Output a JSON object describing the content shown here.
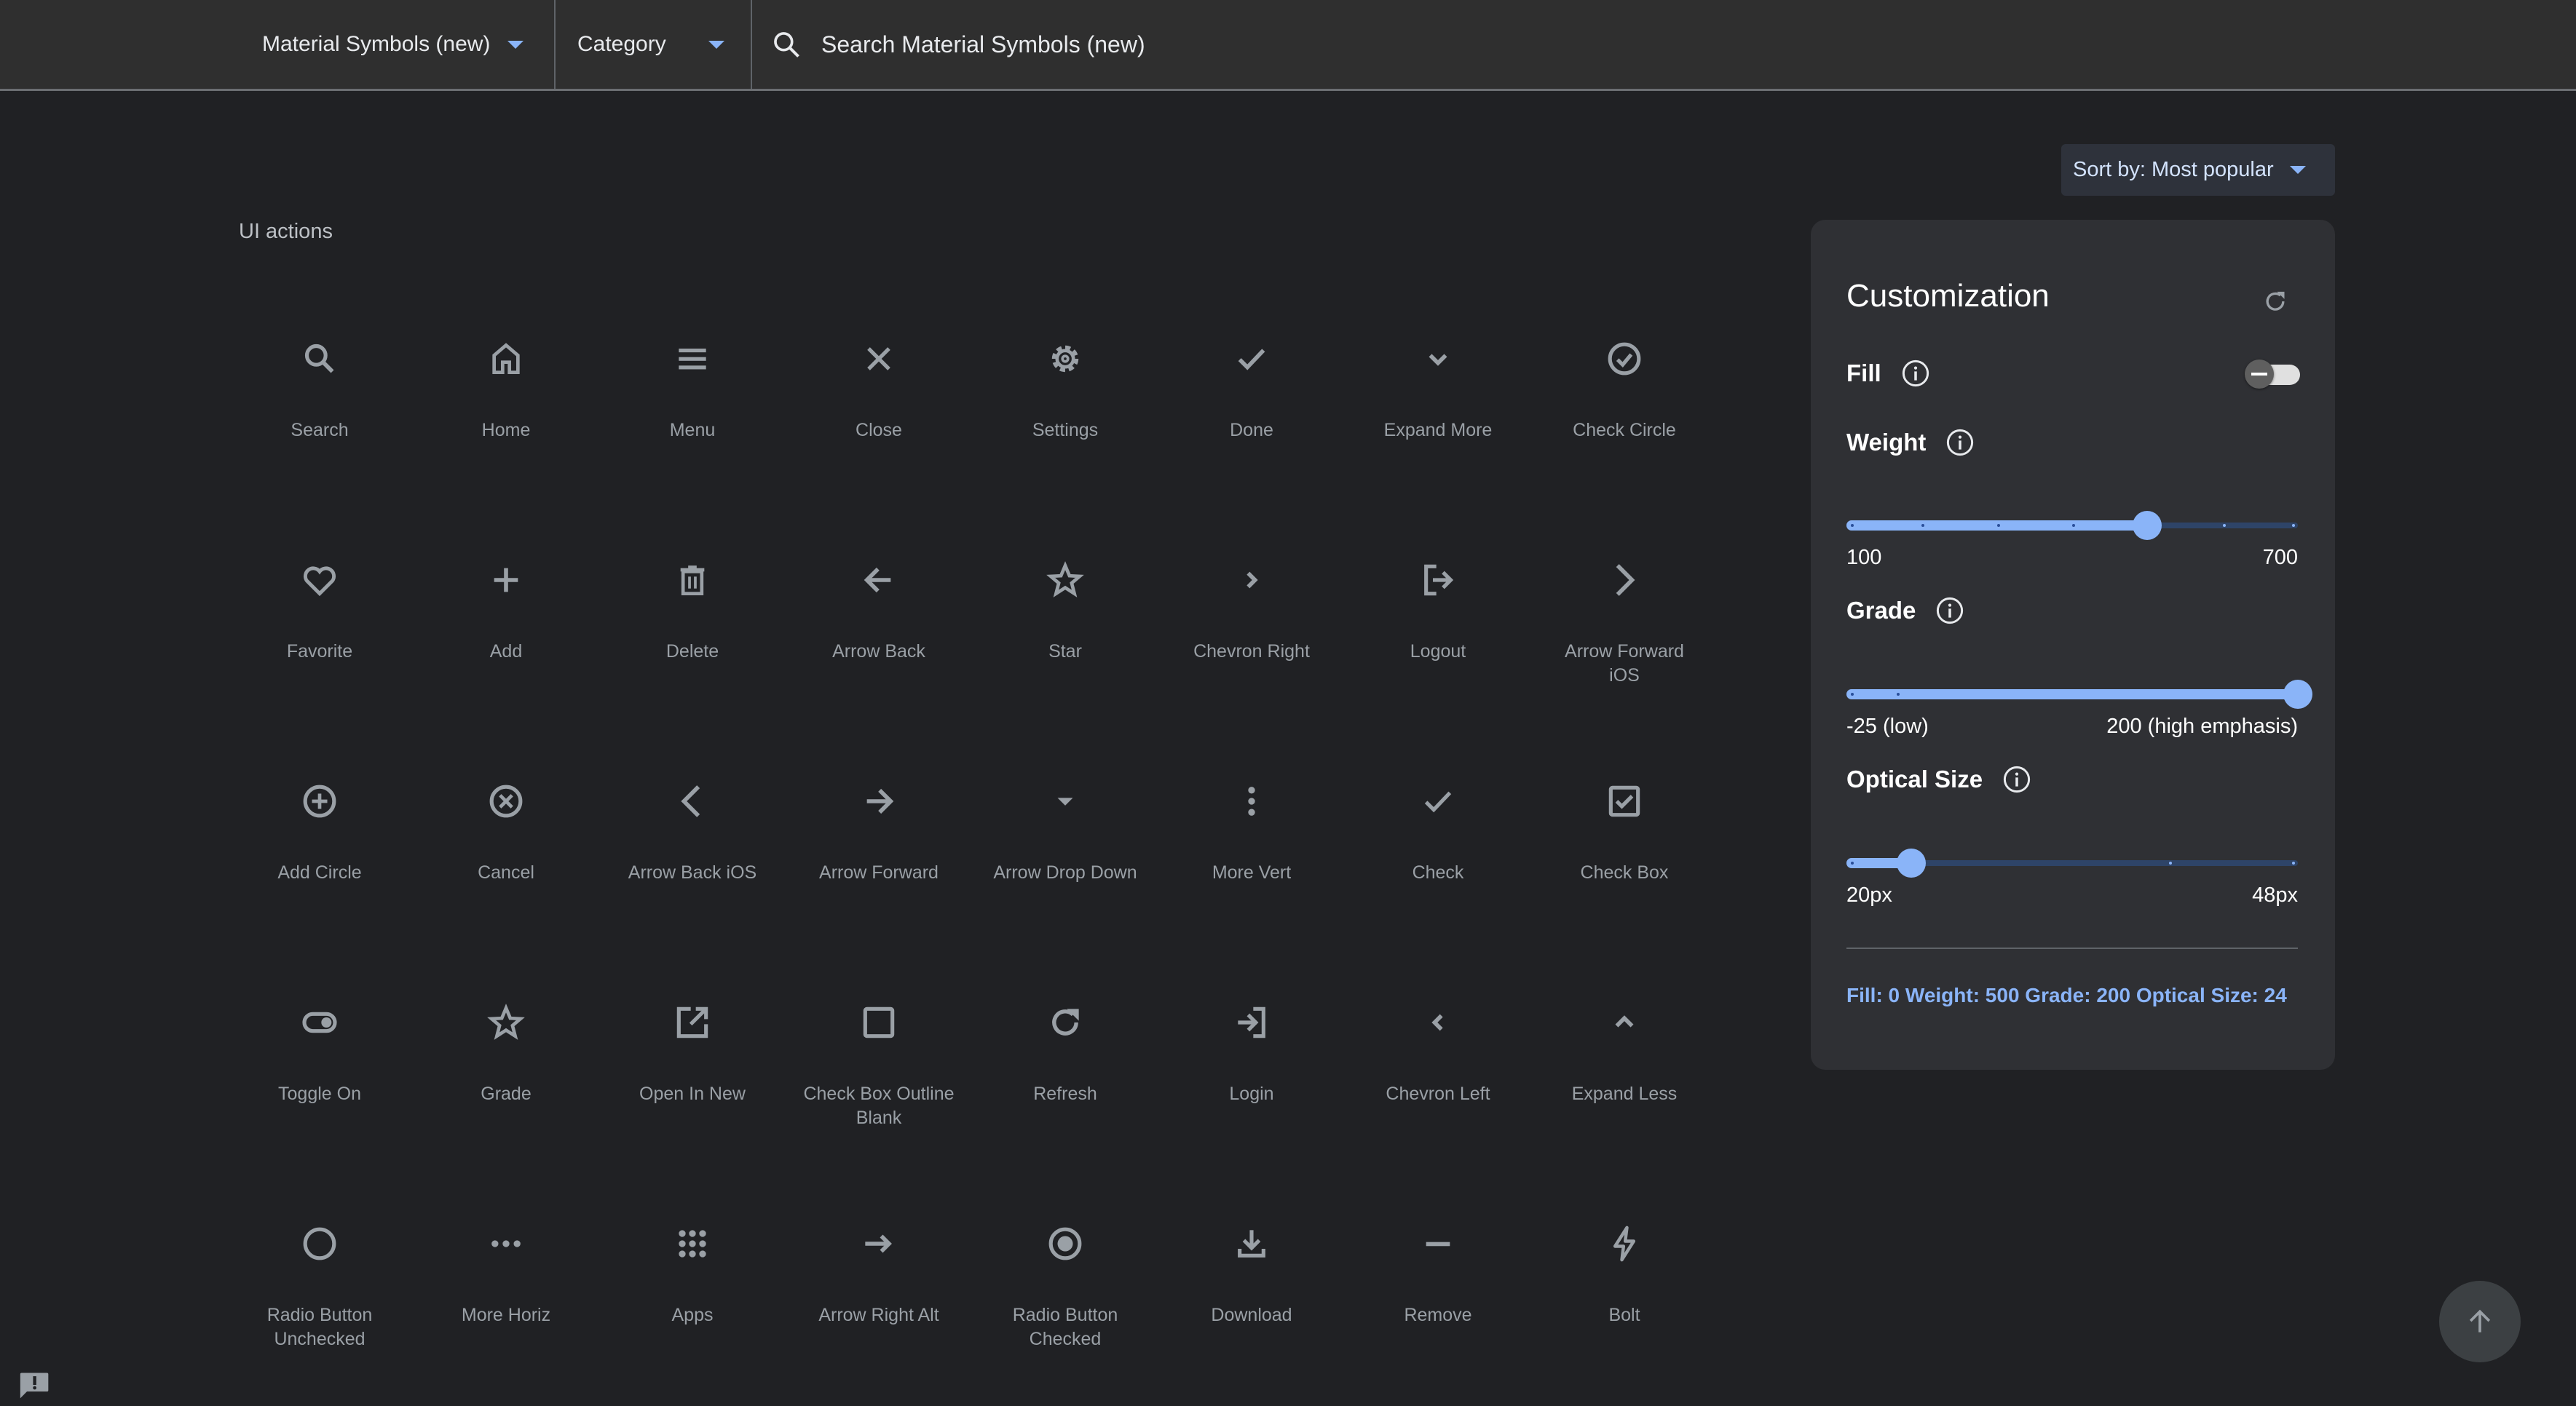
{
  "header": {
    "icon_set_dropdown": "Material Symbols (new)",
    "category_dropdown": "Category",
    "search_placeholder": "Search Material Symbols (new)",
    "search_value": "",
    "search_icon": "search-icon"
  },
  "sort": {
    "label": "Sort by: Most popular"
  },
  "section": {
    "title": "UI actions"
  },
  "icons": [
    {
      "label": "Search",
      "icon": "search"
    },
    {
      "label": "Home",
      "icon": "home"
    },
    {
      "label": "Menu",
      "icon": "menu"
    },
    {
      "label": "Close",
      "icon": "close"
    },
    {
      "label": "Settings",
      "icon": "settings"
    },
    {
      "label": "Done",
      "icon": "done"
    },
    {
      "label": "Expand More",
      "icon": "expand_more"
    },
    {
      "label": "Check Circle",
      "icon": "check_circle"
    },
    {
      "label": "Favorite",
      "icon": "favorite"
    },
    {
      "label": "Add",
      "icon": "add"
    },
    {
      "label": "Delete",
      "icon": "delete"
    },
    {
      "label": "Arrow Back",
      "icon": "arrow_back"
    },
    {
      "label": "Star",
      "icon": "star"
    },
    {
      "label": "Chevron Right",
      "icon": "chevron_right"
    },
    {
      "label": "Logout",
      "icon": "logout"
    },
    {
      "label": "Arrow Forward iOS",
      "icon": "arrow_forward_ios"
    },
    {
      "label": "Add Circle",
      "icon": "add_circle"
    },
    {
      "label": "Cancel",
      "icon": "cancel"
    },
    {
      "label": "Arrow Back iOS",
      "icon": "arrow_back_ios"
    },
    {
      "label": "Arrow Forward",
      "icon": "arrow_forward"
    },
    {
      "label": "Arrow Drop Down",
      "icon": "arrow_drop_down"
    },
    {
      "label": "More Vert",
      "icon": "more_vert"
    },
    {
      "label": "Check",
      "icon": "check"
    },
    {
      "label": "Check Box",
      "icon": "check_box"
    },
    {
      "label": "Toggle On",
      "icon": "toggle_on"
    },
    {
      "label": "Grade",
      "icon": "grade"
    },
    {
      "label": "Open In New",
      "icon": "open_in_new"
    },
    {
      "label": "Check Box Outline Blank",
      "icon": "check_box_outline_blank"
    },
    {
      "label": "Refresh",
      "icon": "refresh"
    },
    {
      "label": "Login",
      "icon": "login"
    },
    {
      "label": "Chevron Left",
      "icon": "chevron_left"
    },
    {
      "label": "Expand Less",
      "icon": "expand_less"
    },
    {
      "label": "Radio Button Unchecked",
      "icon": "radio_button_unchecked"
    },
    {
      "label": "More Horiz",
      "icon": "more_horiz"
    },
    {
      "label": "Apps",
      "icon": "apps"
    },
    {
      "label": "Arrow Right Alt",
      "icon": "arrow_right_alt"
    },
    {
      "label": "Radio Button Checked",
      "icon": "radio_button_checked"
    },
    {
      "label": "Download",
      "icon": "download"
    },
    {
      "label": "Remove",
      "icon": "remove"
    },
    {
      "label": "Bolt",
      "icon": "bolt"
    }
  ],
  "customization": {
    "title": "Customization",
    "fill": {
      "label": "Fill",
      "value": 0,
      "enabled": false
    },
    "weight": {
      "label": "Weight",
      "min": 100,
      "max": 700,
      "value": 500,
      "min_label": "100",
      "max_label": "700",
      "steps": [
        100,
        200,
        300,
        400,
        500,
        600,
        700
      ]
    },
    "grade": {
      "label": "Grade",
      "min": -25,
      "max": 200,
      "value": 200,
      "min_label": "-25 (low)",
      "max_label": "200 (high emphasis)",
      "steps": [
        -25,
        0,
        200
      ]
    },
    "optical_size": {
      "label": "Optical Size",
      "min": 20,
      "max": 48,
      "value": 24,
      "min_label": "20px",
      "max_label": "48px",
      "steps": [
        20,
        24,
        40,
        48
      ]
    },
    "summary": "Fill: 0 Weight: 500 Grade: 200 Optical Size: 24"
  },
  "colors": {
    "accent": "#8ab4f8",
    "icon": "#9aa0a6",
    "background": "#202124",
    "header": "#2f2f2f",
    "panel": "#2f3034"
  }
}
